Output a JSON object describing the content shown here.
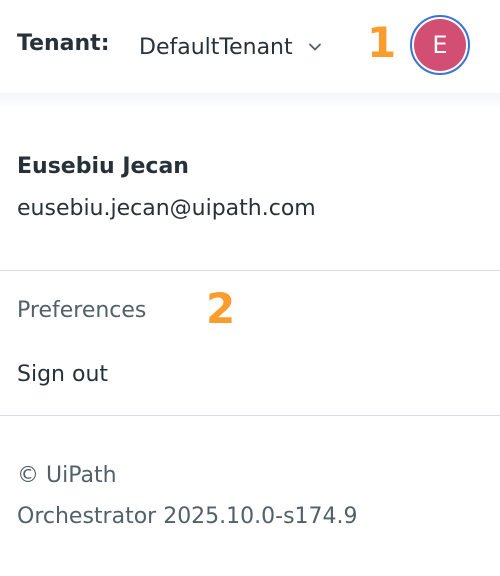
{
  "header": {
    "tenant_label": "Tenant:",
    "tenant_value": "DefaultTenant",
    "tenant_dropdown_icon": "chevron-down-icon",
    "avatar_initial": "E",
    "avatar_color": "#d24e73",
    "avatar_ring_color": "#3b73d8"
  },
  "annotations": {
    "marker_1": "1",
    "marker_2": "2",
    "marker_color": "#fa9d2e"
  },
  "user": {
    "name": "Eusebiu Jecan",
    "email": "eusebiu.jecan@uipath.com"
  },
  "menu": {
    "items": [
      {
        "label": "Preferences"
      },
      {
        "label": "Sign out"
      }
    ]
  },
  "footer": {
    "copyright": "© UiPath",
    "version": "Orchestrator 2025.10.0-s174.9"
  }
}
